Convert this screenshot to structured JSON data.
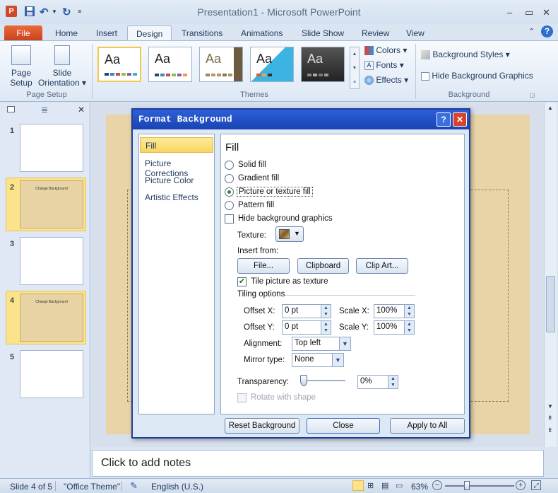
{
  "window": {
    "title": "Presentation1 - Microsoft PowerPoint"
  },
  "qat": {
    "app_icon": "powerpoint-icon",
    "save_icon": "save-icon",
    "undo_icon": "undo-icon",
    "redo_icon": "redo-icon",
    "customize_icon": "customize-qat-icon"
  },
  "window_controls": {
    "minimize": "–",
    "restore": "▭",
    "close": "✕"
  },
  "tabs": [
    {
      "label": "File"
    },
    {
      "label": "Home"
    },
    {
      "label": "Insert"
    },
    {
      "label": "Design"
    },
    {
      "label": "Transitions"
    },
    {
      "label": "Animations"
    },
    {
      "label": "Slide Show"
    },
    {
      "label": "Review"
    },
    {
      "label": "View"
    }
  ],
  "ribbon": {
    "page_setup": {
      "label_line1": "Page",
      "label_line2": "Setup"
    },
    "slide_orientation": {
      "label_line1": "Slide",
      "label_line2": "Orientation ▾"
    },
    "page_setup_group": "Page Setup",
    "themes_group": "Themes",
    "theme_sample": "Aa",
    "colors": "Colors ▾",
    "fonts": "Fonts ▾",
    "effects": "Effects ▾",
    "background_styles": "Background Styles ▾",
    "hide_background_graphics": "Hide Background Graphics",
    "background_group": "Background"
  },
  "slides_panel": {
    "slides": [
      {
        "num": "1",
        "title": ""
      },
      {
        "num": "2",
        "title": "Change Background"
      },
      {
        "num": "3",
        "title": ""
      },
      {
        "num": "4",
        "title": "Change Background"
      },
      {
        "num": "5",
        "title": ""
      }
    ]
  },
  "dialog": {
    "title": "Format Background",
    "help": "?",
    "close": "✕",
    "nav": [
      "Fill",
      "Picture Corrections",
      "Picture Color",
      "Artistic Effects"
    ],
    "heading": "Fill",
    "options": [
      "Solid fill",
      "Gradient fill",
      "Picture or texture fill",
      "Pattern fill"
    ],
    "selected_option": "Picture or texture fill",
    "hide_bg_graphics": "Hide background graphics",
    "texture_label": "Texture:",
    "insert_from": "Insert from:",
    "file_btn": "File...",
    "clipboard_btn": "Clipboard",
    "clipart_btn": "Clip Art...",
    "tile_texture": "Tile picture as texture",
    "tiling_options": "Tiling options",
    "offset_x_label": "Offset X:",
    "offset_x": "0 pt",
    "offset_y_label": "Offset Y:",
    "offset_y": "0 pt",
    "scale_x_label": "Scale X:",
    "scale_x": "100%",
    "scale_y_label": "Scale Y:",
    "scale_y": "100%",
    "alignment_label": "Alignment:",
    "alignment": "Top left",
    "mirror_label": "Mirror type:",
    "mirror": "None",
    "transparency_label": "Transparency:",
    "transparency": "0%",
    "transparency_level": 0,
    "rotate_with_shape": "Rotate with shape",
    "reset_btn": "Reset Background",
    "close_btn": "Close",
    "apply_all_btn": "Apply to All"
  },
  "notes": {
    "placeholder": "Click to add notes"
  },
  "status": {
    "slide": "Slide 4 of 5",
    "theme": "\"Office Theme\"",
    "language": "English (U.S.)",
    "zoom": "63%"
  }
}
